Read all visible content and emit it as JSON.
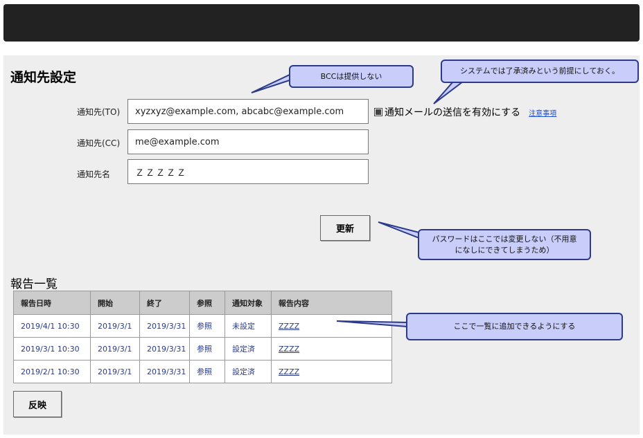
{
  "page": {
    "title": "通知先設定"
  },
  "form": {
    "to_label": "通知先(TO)",
    "to_value": "xyzxyz@example.com, abcabc@example.com",
    "cc_label": "通知先(CC)",
    "cc_value": "me@example.com",
    "name_label": "通知先名",
    "name_value": "ＺＺＺＺＺ",
    "notify_checkbox_label": "通知メールの送信を有効にする",
    "notify_checked": true,
    "notes_link": "注意事項",
    "update_button": "更新"
  },
  "reports": {
    "title": "報告一覧",
    "columns": [
      "報告日時",
      "開始",
      "終了",
      "参照",
      "通知対象",
      "報告内容"
    ],
    "rows": [
      [
        "2019/4/1 10:30",
        "2019/3/1",
        "2019/3/31",
        "参照",
        "未設定",
        "ZZZZ"
      ],
      [
        "2019/3/1 10:30",
        "2019/3/1",
        "2019/3/31",
        "参照",
        "設定済",
        "ZZZZ"
      ],
      [
        "2019/2/1 10:30",
        "2019/3/1",
        "2019/3/31",
        "参照",
        "設定済",
        "ZZZZ"
      ]
    ],
    "apply_button": "反映"
  },
  "callouts": {
    "bcc": "BCCは提供しない",
    "system": "システムでは了承済みという前提にしておく。",
    "password": "パスワードはここでは変更しない（不用意\nになしにできてしまうため）",
    "list": "ここで一覧に追加できるようにする"
  },
  "colors": {
    "topbar": "#222222",
    "panel": "#eeeeee",
    "callout_fill": "#c9cdfa",
    "callout_border": "#2c3a8a",
    "link": "#1a4fd0"
  }
}
